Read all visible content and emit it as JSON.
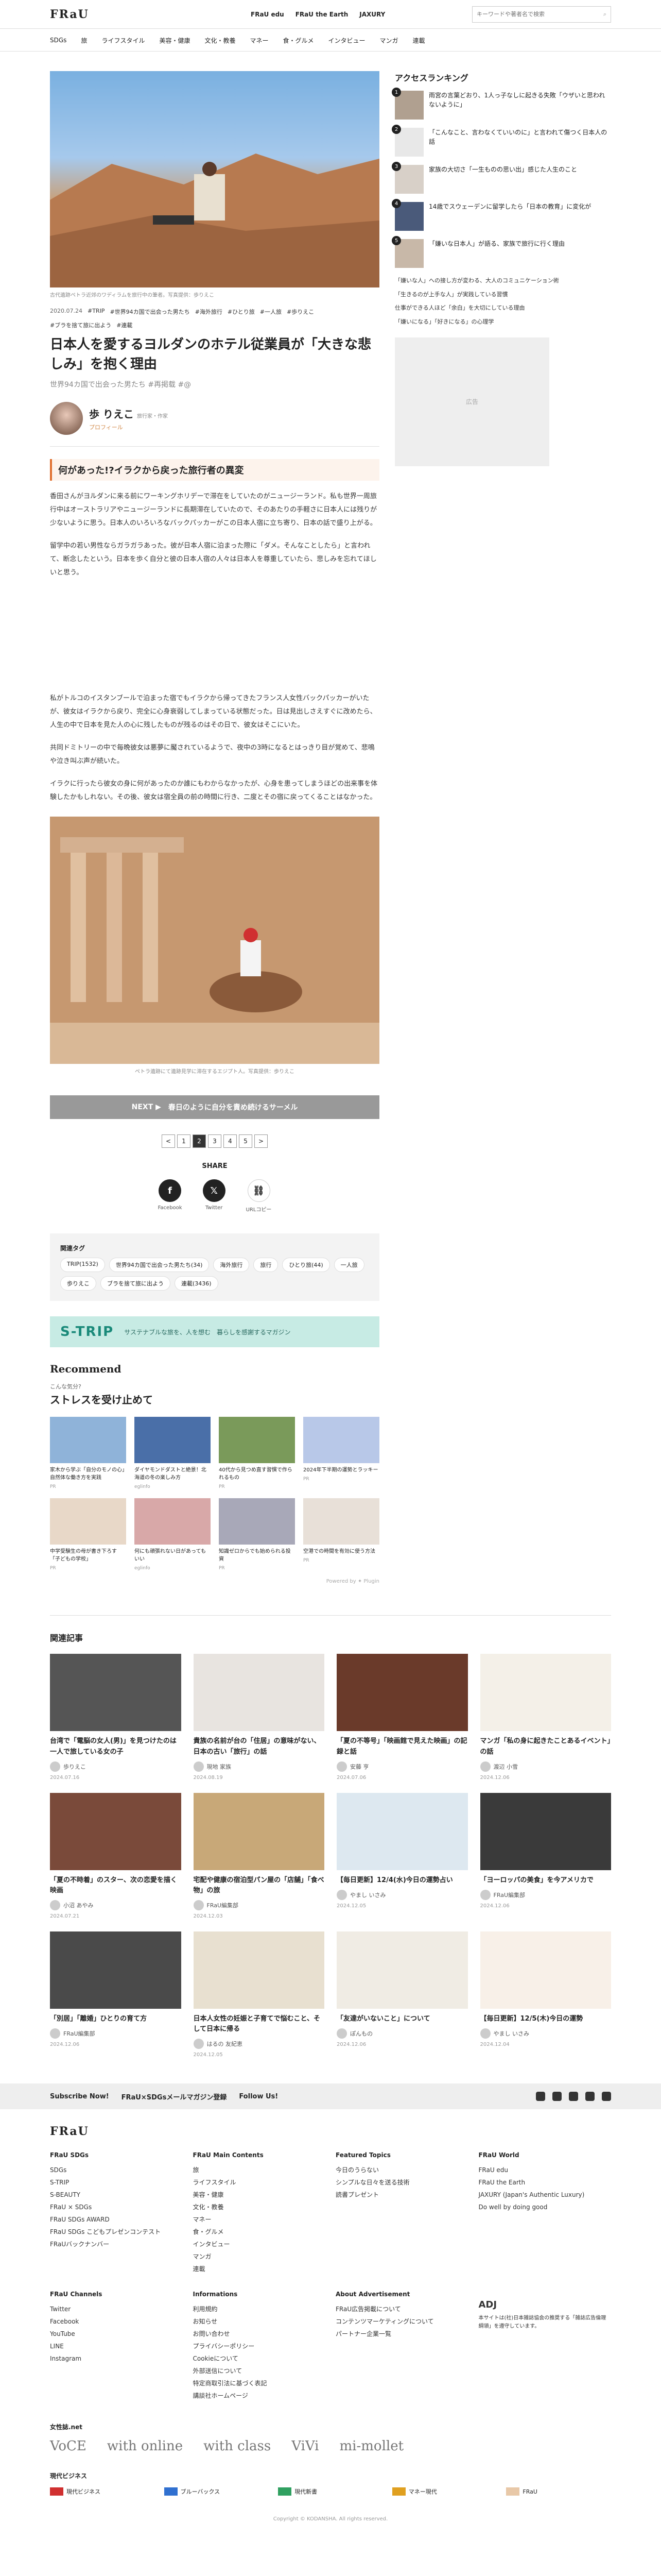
{
  "header": {
    "logo": "FRaU",
    "links": [
      "FRaU edu",
      "FRaU the Earth",
      "JAXURY"
    ],
    "search_placeholder": "キーワードや著者名で検索"
  },
  "nav": [
    "SDGs",
    "旅",
    "ライフスタイル",
    "美容・健康",
    "文化・教養",
    "マネー",
    "食・グルメ",
    "インタビュー",
    "マンガ",
    "連載"
  ],
  "hero": {
    "caption": "古代遺跡ペトラ近郊のワディラムを旅行中の筆者。写真提供：歩りえこ"
  },
  "meta": {
    "date": "2020.07.24",
    "tags": [
      "#TRIP",
      "#世界94カ国で出会った男たち",
      "#海外旅行",
      "#ひとり旅",
      "#一人旅",
      "#歩りえこ",
      "#ブラを捨て旅に出よう",
      "#連載"
    ]
  },
  "title": "日本人を愛するヨルダンのホテル従業員が「大きな悲しみ」を抱く理由",
  "subtitle": "世界94カ国で出会った男たち #再掲载 #@",
  "author": {
    "name": "歩 りえこ",
    "role": "旅行家・作家",
    "profile": "プロフィール"
  },
  "section1": "何があった!?イラクから戻った旅行者の異変",
  "paras": [
    "香田さんがヨルダンに来る前にワーキングホリデーで滞在をしていたのがニュージーランド。私も世界一周旅行中はオーストラリアやニュージーランドに長期滞在していたので、そのあたりの手軽さに日本人には残りが少ないように思う。日本人のいろいろなバックパッカーがこの日本人宿に立ち寄り、日本の話で盛り上がる。",
    "留学中の若い男性ならガラガラあった。彼が日本人宿に泊まった際に「ダメ。そんなことしたら」と言われて、断念したという。日本を歩く自分と彼の日本人宿の人々は日本人を尊重していたら、悲しみを忘れてほしいと思う。",
    "私がトルコのイスタンブールで泊まった宿でもイラクから帰ってきたフランス人女性バックパッカーがいたが、彼女はイラクから戻り、完全に心身衰弱してしまっている状態だった。日は見出しさえすぐに改めたら、人生の中で日本を見た人の心に残したものが残るのはその日で、彼女はそこにいた。",
    "共同ドミトリーの中で毎晩彼女は悪夢に魘されているようで、夜中の3時になるとはっきり目が覚めて、悲鳴や泣き叫ぶ声が続いた。",
    "イラクに行ったら彼女の身に何があったのか誰にもわからなかったが、心身を患ってしまうほどの出来事を体験したかもしれない。その後、彼女は宿全員の前の時間に行き、二度とその宿に戻ってくることはなかった。"
  ],
  "photo2": {
    "caption": "ペトラ遺跡にて遺跡見学に滞在するエジプト人。写真提供：歩りえこ"
  },
  "next": {
    "label": "NEXT ▶",
    "text": "春日のように自分を責め続けるサーメル"
  },
  "pager": [
    "<",
    "1",
    "2",
    "3",
    "4",
    "5",
    ">"
  ],
  "pager_current": "2",
  "share": {
    "label": "SHARE",
    "items": [
      "Facebook",
      "Twitter",
      "URLコピー"
    ]
  },
  "tagbox": {
    "title": "関連タグ",
    "tags": [
      "TRIP(1532)",
      "世界94カ国で出会った男たち(34)",
      "海外旅行",
      "旅行",
      "ひとり旅(44)",
      "一人旅",
      "歩りえこ",
      "ブラを捨て旅に出よう",
      "連載(3436)"
    ]
  },
  "strip": {
    "logo": "S-TRIP",
    "text": "サステナブルな旅を、人を想む　暮らしを感謝するマガジン"
  },
  "recommend": {
    "head": "Recommend",
    "sub": "こんな気分?",
    "title": "ストレスを受け止めて",
    "items": [
      {
        "t": "家木から学ぶ「自分のモノの心」自然体な働き方を実践",
        "s": "PR"
      },
      {
        "t": "ダイヤモンドダストと絶景！北海道の冬の楽しみ方",
        "s": "eglinfo"
      },
      {
        "t": "40代から見つめ直す習慣で作られるもの",
        "s": "PR"
      },
      {
        "t": "2024年下半期の運勢とラッキー",
        "s": "PR"
      },
      {
        "t": "中学受験生の母が書き下ろす「子どもの学校」",
        "s": "PR"
      },
      {
        "t": "何にも頑張れない日があってもいい",
        "s": "eglinfo"
      },
      {
        "t": "知識ゼロからでも始められる投資",
        "s": "PR"
      },
      {
        "t": "空港での時間を有効に使う方法",
        "s": "PR"
      }
    ],
    "powered": "Powered by ✦ Plugin"
  },
  "sidebar": {
    "title": "アクセスランキング",
    "ranks": [
      "雨宮の言葉どおり、1人っ子なしに起きる失敗「ウザいと思われないように」",
      "「こんなこと、言わなくていいのに」と言われて傷つく日本人の話",
      "家族の大切さ「一生ものの思い出」感じた人生のこと",
      "14歳でスウェーデンに留学したら「日本の教育」に変化が",
      "「嫌いな日本人」が語る、家族で旅行に行く理由"
    ],
    "small": [
      "「嫌いな人」への接し方が変わる、大人のコミュニケーション術",
      "「生きるのが上手な人」が実践している習慣",
      "仕事ができる人ほど「余白」を大切にしている理由",
      "「嫌いになる」「好きになる」の心理学"
    ],
    "ad": "広告"
  },
  "related": {
    "title": "関連記事",
    "items": [
      {
        "t": "台湾で「電脳の女人(男)」を見つけたのは一人で旅している女の子",
        "a": "歩りえこ",
        "d": "2024.07.16"
      },
      {
        "t": "貴族の名前が台の「住居」の意味がない、日本の古い「旅行」の話",
        "a": "現地 家族",
        "d": "2024.08.19"
      },
      {
        "t": "「夏の不等号」「映画館で見えた映画」の記録と話",
        "a": "安藤 亨",
        "d": "2024.07.06"
      },
      {
        "t": "マンガ「私の身に起きたことあるイベント」の話",
        "a": "渡辺 小雪",
        "d": "2024.12.06"
      },
      {
        "t": "「夏の不時着」のスター、次の恋愛を描く映画",
        "a": "小沼 あやみ",
        "d": "2024.07.21"
      },
      {
        "t": "宅配や健康の宿泊型パン屋の「店舗」「食べ物」の旅",
        "a": "FRaU編集部",
        "d": "2024.12.03"
      },
      {
        "t": "【毎日更新】12/4(水)今日の運勢占い",
        "a": "やまし いさみ",
        "d": "2024.12.05"
      },
      {
        "t": "「ヨーロッパの美食」を今アメリカで",
        "a": "FRaU編集部",
        "d": "2024.12.06"
      },
      {
        "t": "「別居」「離婚」ひとりの育て方",
        "a": "FRaU編集部",
        "d": "2024.12.06"
      },
      {
        "t": "日本人女性の妊娠と子育てで悩むこと、そして日本に帰る",
        "a": "はるの 友紀恵",
        "d": "2024.12.05"
      },
      {
        "t": "「友達がいないこと」について",
        "a": "ぽんもの",
        "d": "2024.12.06"
      },
      {
        "t": "【毎日更新】12/5(木)今日の運勢",
        "a": "やまし いさみ",
        "d": "2024.12.04"
      }
    ]
  },
  "subbar": {
    "a": "Subscribe Now!",
    "b": "FRaU×SDGsメールマガジン登録",
    "c": "Follow Us!"
  },
  "footer": {
    "logo": "FRaU",
    "cols": [
      {
        "h": "FRaU SDGs",
        "items": [
          "SDGs",
          "S-TRIP",
          "S-BEAUTY",
          "FRaU × SDGs",
          "FRaU SDGs AWARD",
          "FRaU SDGs こどもプレゼンコンテスト",
          "FRaUバックナンバー"
        ]
      },
      {
        "h": "FRaU Main Contents",
        "items": [
          "旅",
          "ライフスタイル",
          "美容・健康",
          "文化・教養",
          "マネー",
          "食・グルメ",
          "インタビュー",
          "マンガ",
          "連載"
        ]
      },
      {
        "h": "Featured Topics",
        "items": [
          "今日のうらない",
          "シンプルな日々を送る技術",
          "読書プレゼント"
        ]
      },
      {
        "h": "FRaU World",
        "items": [
          "FRaU edu",
          "FRaU the Earth",
          "JAXURY (Japan's Authentic Luxury)",
          "Do well by doing good"
        ]
      }
    ],
    "cols2": [
      {
        "h": "FRaU Channels",
        "items": [
          "Twitter",
          "Facebook",
          "YouTube",
          "LINE",
          "Instagram"
        ]
      },
      {
        "h": "Informations",
        "items": [
          "利用規約",
          "お知らせ",
          "お問い合わせ",
          "プライバシーポリシー",
          "Cookieについて",
          "外部送信について",
          "特定商取引法に基づく表記",
          "講談社ホームページ"
        ]
      },
      {
        "h": "About Advertisement",
        "items": [
          "FRaU広告掲載について",
          "コンテンツマーケティングについて",
          "パートナー企業一覧"
        ]
      },
      {
        "h": "",
        "items": [
          "ADJ",
          "本サイトは(社)日本雑誌協会の推奨する「雑誌広告倫理綱領」を遵守しています。"
        ]
      }
    ],
    "js": "女性誌.net",
    "jsitems": [
      "VoCE",
      "with online",
      "with class",
      "ViVi",
      "mi-mollet"
    ],
    "gm": "現代ビジネス",
    "gitems": [
      "現代ビジネス",
      "ブルーバックス",
      "現代新書",
      "マネー現代",
      "FRaU"
    ],
    "copy": "Copyright © KODANSHA. All rights reserved."
  },
  "colors": {
    "accent": "#e07030",
    "strip": "#c7ebe4"
  }
}
